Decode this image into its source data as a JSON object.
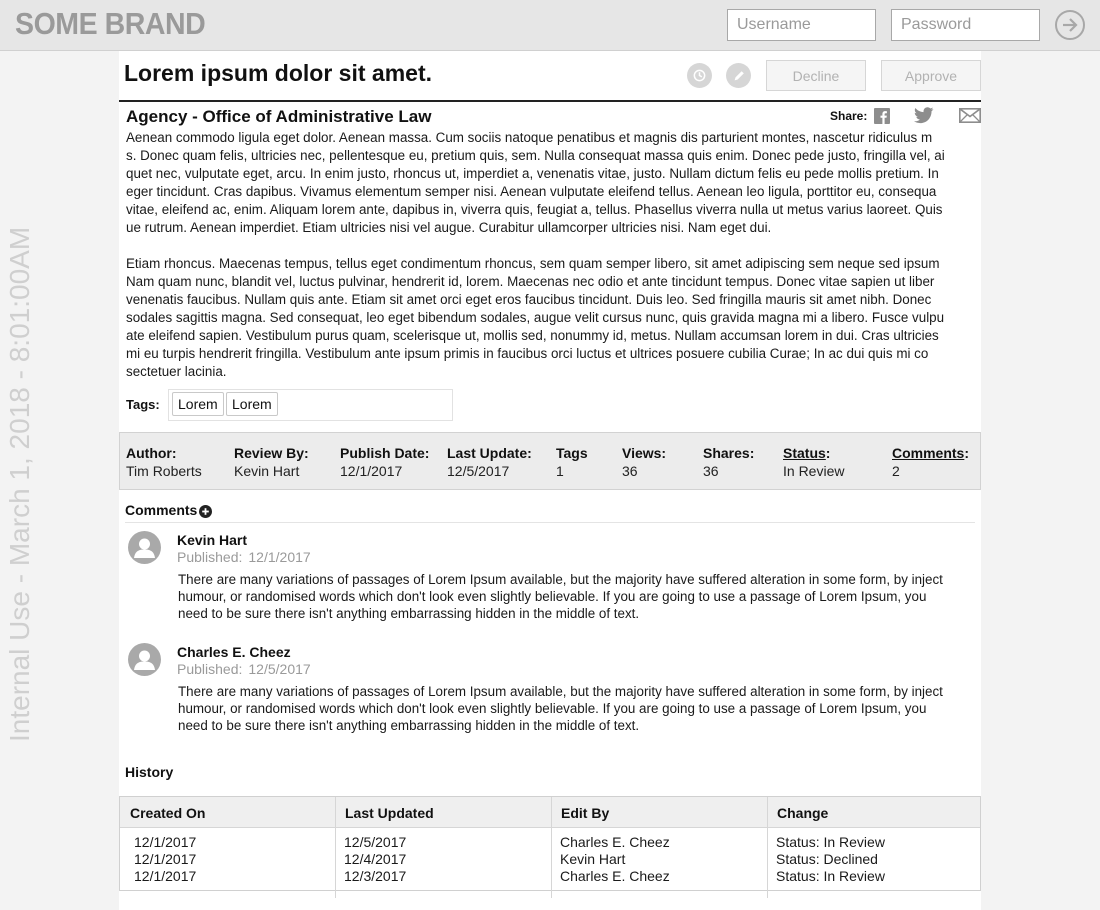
{
  "header": {
    "brand": "SOME BRAND",
    "username_placeholder": "Username",
    "password_placeholder": "Password"
  },
  "watermark": "Internal Use - March 1, 2018 - 8:01:00AM",
  "article": {
    "title": "Lorem ipsum dolor sit amet.",
    "decline_label": "Decline",
    "approve_label": "Approve",
    "agency": "Agency - Office of Administrative Law",
    "share_label": "Share:",
    "paragraph1_lines": [
      "Aenean commodo ligula eget dolor. Aenean massa. Cum sociis natoque penatibus et magnis dis parturient montes, nascetur ridiculus m",
      "s. Donec quam felis, ultricies nec, pellentesque eu, pretium quis, sem. Nulla consequat massa quis enim. Donec pede justo, fringilla vel, ai",
      "quet nec, vulputate eget, arcu. In enim justo, rhoncus ut, imperdiet a, venenatis vitae, justo. Nullam dictum felis eu pede mollis pretium. In",
      "eger tincidunt. Cras dapibus. Vivamus elementum semper nisi. Aenean vulputate eleifend tellus. Aenean leo ligula, porttitor eu, consequa",
      "vitae, eleifend ac, enim. Aliquam lorem ante, dapibus in, viverra quis, feugiat a, tellus. Phasellus viverra nulla ut metus varius laoreet. Quis",
      "ue rutrum. Aenean imperdiet. Etiam ultricies nisi vel augue. Curabitur ullamcorper ultricies nisi. Nam eget dui."
    ],
    "paragraph2_lines": [
      "Etiam rhoncus. Maecenas tempus, tellus eget condimentum rhoncus, sem quam semper libero, sit amet adipiscing sem neque sed ipsum",
      "Nam quam nunc, blandit vel, luctus pulvinar, hendrerit id, lorem. Maecenas nec odio et ante tincidunt tempus. Donec vitae sapien ut liber",
      "venenatis faucibus. Nullam quis ante. Etiam sit amet orci eget eros faucibus tincidunt. Duis leo. Sed fringilla mauris sit amet nibh. Donec",
      "sodales sagittis magna. Sed consequat, leo eget bibendum sodales, augue velit cursus nunc, quis gravida magna mi a libero. Fusce vulpu",
      "ate eleifend sapien. Vestibulum purus quam, scelerisque ut, mollis sed, nonummy id, metus. Nullam accumsan lorem in dui. Cras ultricies",
      "mi eu turpis hendrerit fringilla. Vestibulum ante ipsum primis in faucibus orci luctus et ultrices posuere cubilia Curae; In ac dui quis mi co",
      "sectetuer lacinia."
    ],
    "tags_label": "Tags:",
    "tags": [
      "Lorem",
      "Lorem"
    ]
  },
  "meta": {
    "author_label": "Author:",
    "author": "Tim Roberts",
    "review_label": "Review By:",
    "review": "Kevin Hart",
    "publish_label": "Publish Date:",
    "publish": "12/1/2017",
    "update_label": "Last Update:",
    "update": "12/5/2017",
    "tags_label": "Tags",
    "tags": "1",
    "views_label": "Views:",
    "views": "36",
    "shares_label": "Shares:",
    "shares": "36",
    "status_label": "Status",
    "status_colon": ":",
    "status": "In Review",
    "comments_label": "Comments",
    "comments_colon": ":",
    "comments": "2"
  },
  "comments": {
    "heading": "Comments",
    "items": [
      {
        "name": "Kevin Hart",
        "published_label": "Published:",
        "date": "12/1/2017",
        "lines": [
          "There are many variations of passages of Lorem Ipsum available, but the majority have suffered alteration in some form, by inject",
          "humour, or randomised words which don't look even slightly believable. If you are going to use a passage of Lorem Ipsum, you",
          "need to be sure there isn't anything embarrassing hidden in the middle of text."
        ]
      },
      {
        "name": "Charles E. Cheez",
        "published_label": "Published:",
        "date": "12/5/2017",
        "lines": [
          "There are many variations of passages of Lorem Ipsum available, but the majority have suffered alteration in some form, by inject",
          "humour, or randomised words which don't look even slightly believable. If you are going to use a passage of Lorem Ipsum, you",
          "need to be sure there isn't anything embarrassing hidden in the middle of text."
        ]
      }
    ]
  },
  "history": {
    "heading": "History",
    "columns": [
      "Created On",
      "Last Updated",
      "Edit By",
      "Change"
    ],
    "rows": [
      [
        "12/1/2017",
        "12/5/2017",
        "Charles E. Cheez",
        "Status: In Review"
      ],
      [
        "12/1/2017",
        "12/4/2017",
        "Kevin Hart",
        "Status: Declined"
      ],
      [
        "12/1/2017",
        "12/3/2017",
        "Charles E. Cheez",
        "Status: In Review"
      ]
    ]
  }
}
